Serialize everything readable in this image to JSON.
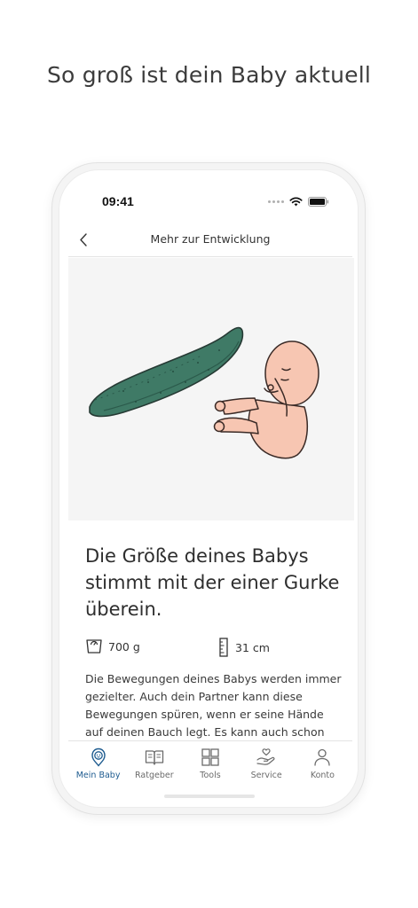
{
  "promo": {
    "title": "So groß ist dein Baby aktuell"
  },
  "status_bar": {
    "time": "09:41"
  },
  "header": {
    "title": "Mehr zur Entwicklung",
    "back_icon": "chevron-left-icon"
  },
  "content": {
    "headline": "Die Größe deines Babys stimmt mit der einer Gurke überein.",
    "weight": "700 g",
    "length": "31 cm",
    "description": "Die Bewegungen deines Babys werden immer gezielter. Auch dein Partner kann diese Bewegungen spüren, wenn er seine Hände auf deinen Bauch legt. Es kann auch schon mal"
  },
  "tabs": [
    {
      "label": "Mein Baby",
      "icon": "baby-icon",
      "active": true
    },
    {
      "label": "Ratgeber",
      "icon": "book-icon",
      "active": false
    },
    {
      "label": "Tools",
      "icon": "grid-icon",
      "active": false
    },
    {
      "label": "Service",
      "icon": "hand-heart-icon",
      "active": false
    },
    {
      "label": "Konto",
      "icon": "person-icon",
      "active": false
    }
  ],
  "colors": {
    "accent": "#1d5b8f",
    "cucumber": "#3f7a66",
    "baby_skin": "#f7c6b2"
  }
}
